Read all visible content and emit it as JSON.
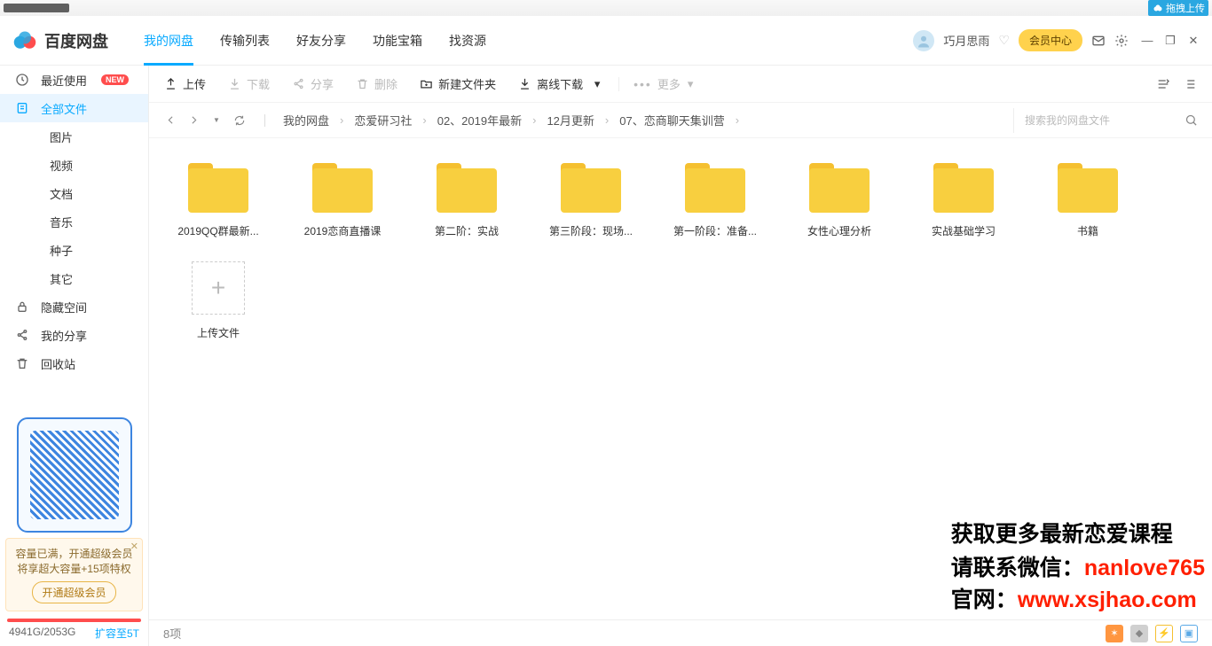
{
  "app_title": "百度网盘",
  "drag_label": "拖拽上传",
  "nav": [
    "我的网盘",
    "传输列表",
    "好友分享",
    "功能宝箱",
    "找资源"
  ],
  "nav_active": 0,
  "user": {
    "name": "巧月思雨"
  },
  "vip_label": "会员中心",
  "sidebar": {
    "items": [
      {
        "label": "最近使用",
        "icon": "clock",
        "badge": "NEW"
      },
      {
        "label": "全部文件",
        "icon": "files",
        "active": true
      },
      {
        "label": "图片",
        "child": true
      },
      {
        "label": "视频",
        "child": true
      },
      {
        "label": "文档",
        "child": true
      },
      {
        "label": "音乐",
        "child": true
      },
      {
        "label": "种子",
        "child": true
      },
      {
        "label": "其它",
        "child": true
      },
      {
        "label": "隐藏空间",
        "icon": "lock"
      },
      {
        "label": "我的分享",
        "icon": "share"
      },
      {
        "label": "回收站",
        "icon": "trash"
      }
    ]
  },
  "promo": {
    "line1": "容量已满，开通超级会员",
    "line2": "将享超大容量+15项特权",
    "btn": "开通超级会员"
  },
  "storage": {
    "text": "4941G/2053G",
    "expand": "扩容至5T"
  },
  "toolbar": {
    "upload": "上传",
    "download": "下载",
    "share": "分享",
    "delete": "删除",
    "newfolder": "新建文件夹",
    "offline": "离线下载",
    "more": "更多"
  },
  "breadcrumb": [
    "我的网盘",
    "恋爱研习社",
    "02、2019年最新",
    "12月更新",
    "07、恋商聊天集训营"
  ],
  "search": {
    "placeholder": "搜索我的网盘文件"
  },
  "folders": [
    "2019QQ群最新...",
    "2019恋商直播课",
    "第二阶：实战",
    "第三阶段：现场...",
    "第一阶段：准备...",
    "女性心理分析",
    "实战基础学习",
    "书籍"
  ],
  "upload_tile": "上传文件",
  "status": {
    "count": "8项"
  },
  "overlay": {
    "line1": "获取更多最新恋爱课程",
    "line2a": "请联系微信：",
    "line2b": "nanlove765",
    "line3a": "官网：",
    "line3b": "www.xsjhao.com"
  }
}
